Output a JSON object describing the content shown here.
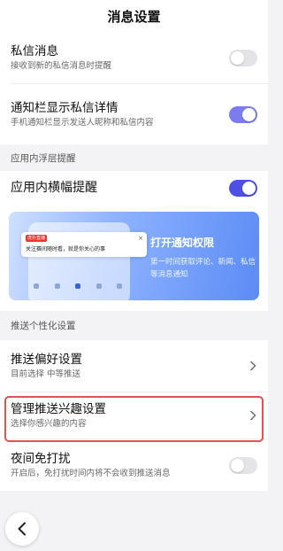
{
  "header": {
    "title": "消息设置"
  },
  "private_section": {
    "items": [
      {
        "title": "私信消息",
        "sub": "接收到新的私信消息时提醒",
        "toggle": "off"
      },
      {
        "title": "通知栏显示私信详情",
        "sub": "手机通知栏显示发送人昵称和私信内容",
        "toggle": "on"
      }
    ]
  },
  "float_section": {
    "label": "应用内浮层提醒",
    "item": {
      "title": "应用内横幅提醒",
      "toggle": "on"
    },
    "banner": {
      "notif_app": "虎扑直播",
      "notif_msg": "关注赛间随时看，就是你关心的事",
      "notif_close": "×",
      "title": "打开通知权限",
      "desc": "第一时间获取评论、新闻、私信等消息通知"
    }
  },
  "push_section": {
    "label": "推送个性化设置",
    "items": [
      {
        "title": "推送偏好设置",
        "sub": "目前选择 中等推送"
      },
      {
        "title": "管理推送兴趣设置",
        "sub": "选择你感兴趣的内容"
      },
      {
        "title": "夜间免打扰",
        "sub": "开启后，免打扰时间内将不会收到推送消息",
        "toggle": "off"
      }
    ]
  },
  "icons": {
    "chevron": "chevron-right-icon",
    "back": "back-arrow-icon",
    "close": "close-icon"
  },
  "colors": {
    "toggle_on": "#7c7cf0",
    "toggle_on_strong": "#4f4fe6",
    "highlight": "#e15252",
    "banner_blue": "#5b8cf5"
  }
}
